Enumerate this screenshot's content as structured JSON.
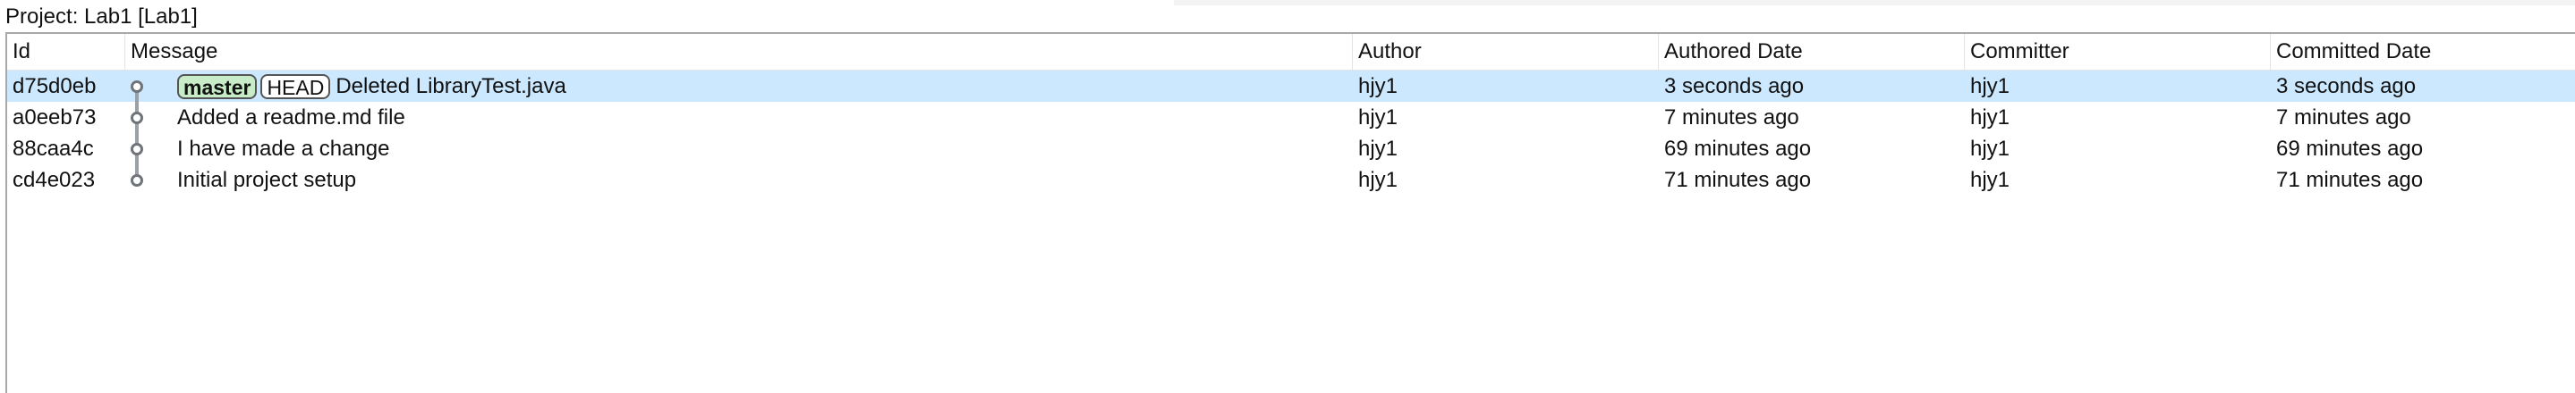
{
  "window": {
    "title": "Project: Lab1 [Lab1]"
  },
  "columns": {
    "id": "Id",
    "message": "Message",
    "author": "Author",
    "authored_date": "Authored Date",
    "committer": "Committer",
    "committed_date": "Committed Date"
  },
  "commits": [
    {
      "id": "d75d0eb",
      "branch": "master",
      "head": "HEAD",
      "message": "Deleted LibraryTest.java",
      "author": "hjy1",
      "authored_date": "3 seconds ago",
      "committer": "hjy1",
      "committed_date": "3 seconds ago",
      "selected": true
    },
    {
      "id": "a0eeb73",
      "message": "Added a readme.md file",
      "author": "hjy1",
      "authored_date": "7 minutes ago",
      "committer": "hjy1",
      "committed_date": "7 minutes ago"
    },
    {
      "id": "88caa4c",
      "message": "I have made a change",
      "author": "hjy1",
      "authored_date": "69 minutes ago",
      "committer": "hjy1",
      "committed_date": "69 minutes ago"
    },
    {
      "id": "cd4e023",
      "message": "Initial project setup",
      "author": "hjy1",
      "authored_date": "71 minutes ago",
      "committer": "hjy1",
      "committed_date": "71 minutes ago"
    }
  ],
  "colors": {
    "selection": "#cce8ff",
    "branch_badge": "#c8ecc8",
    "graph_line": "#9aa0a6"
  }
}
